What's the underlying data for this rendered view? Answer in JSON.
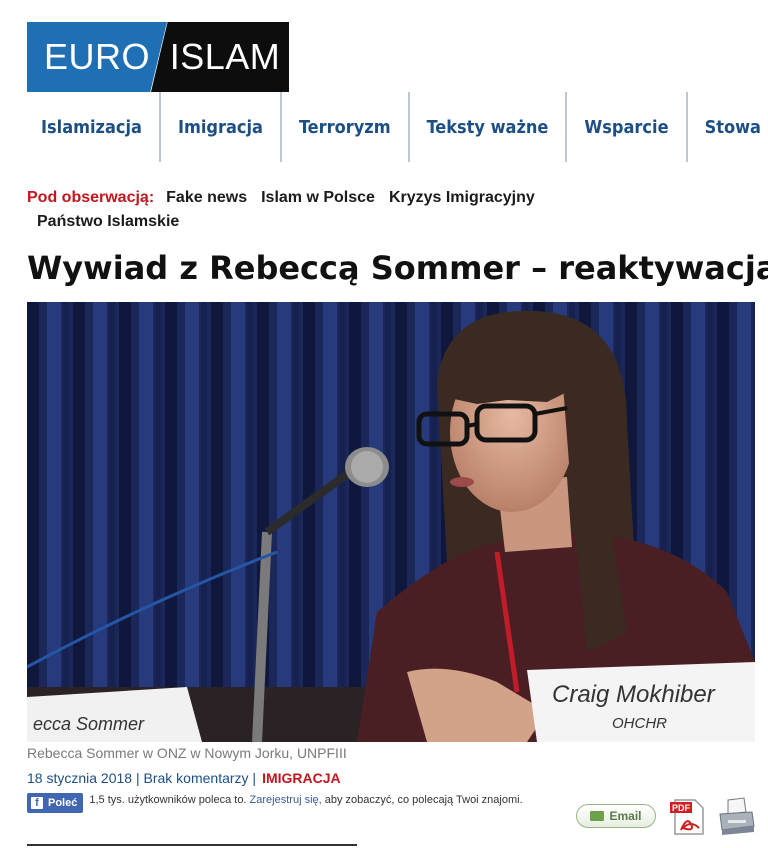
{
  "logo": {
    "part1": "EURO",
    "part2": "ISLAM"
  },
  "nav": [
    "Islamizacja",
    "Imigracja",
    "Terroryzm",
    "Teksty ważne",
    "Wsparcie",
    "Stowa"
  ],
  "watch": {
    "label": "Pod obserwacją:",
    "items": [
      "Fake news",
      "Islam w Polsce",
      "Kryzys Imigracyjny",
      "Państwo Islamskie"
    ]
  },
  "article": {
    "title": "Wywiad z Rebeccą Sommer – reaktywacja",
    "photo_nameplate_left": "ecca Sommer",
    "photo_nameplate_right_name": "Craig Mokhiber",
    "photo_nameplate_right_org": "OHCHR",
    "caption": "Rebecca Sommer w ONZ w Nowym Jorku, UNPFIII",
    "meta_date": "18 stycznia 2018",
    "meta_sep1": " | ",
    "meta_comments": "Brak komentarzy",
    "meta_sep2": " |",
    "category": "IMIGRACJA"
  },
  "share": {
    "fb_button": "Poleć",
    "fb_text_before": "1,5 tys. użytkowników poleca to. ",
    "fb_link": "Zarejestruj się,",
    "fb_text_after": " aby zobaczyć, co polecają Twoi znajomi.",
    "email_label": "Email",
    "pdf_label": "PDF"
  },
  "colors": {
    "accent_blue": "#1f6fb4",
    "nav_text": "#1d4f84",
    "accent_red": "#c0161d"
  }
}
